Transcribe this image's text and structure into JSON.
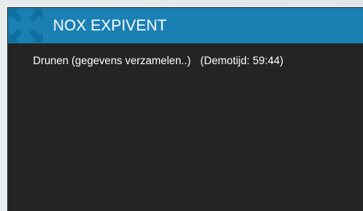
{
  "app": {
    "title": "NOX EXPIVENT",
    "logo_icon": "compress-arrows-icon",
    "colors": {
      "titlebar": "#1a80b4",
      "logo": "#0f6f9e",
      "window_bg": "#242424",
      "text": "#ffffff"
    }
  },
  "status": {
    "location": "Drunen (gegevens verzamelen..)",
    "demo_time": "(Demotijd: 59:44)"
  }
}
